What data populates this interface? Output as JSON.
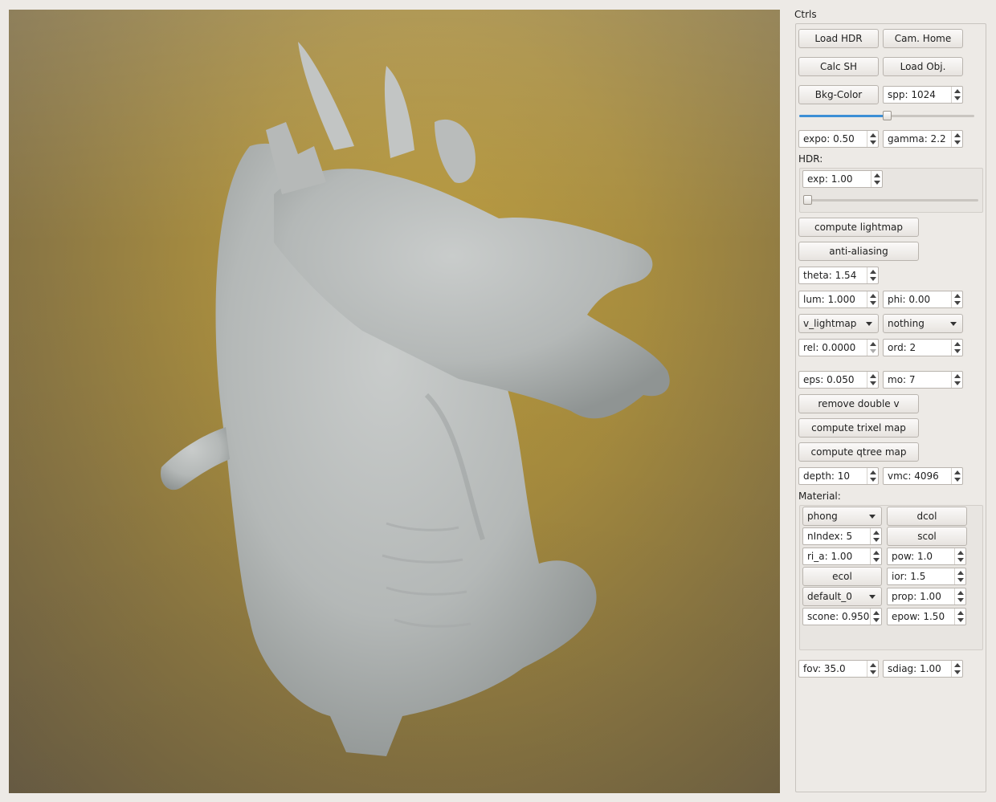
{
  "controls": {
    "title": "Ctrls",
    "load_hdr": "Load HDR",
    "cam_home": "Cam. Home",
    "calc_sh": "Calc SH",
    "load_obj": "Load Obj.",
    "bkg_color": "Bkg-Color",
    "spp": "spp: 1024",
    "spp_slider_level": 0.5,
    "expo": "expo: 0.50",
    "gamma": "gamma: 2.2",
    "hdr_label": "HDR:",
    "hdr_exp": "exp: 1.00",
    "hdr_slider_level": 0.0,
    "compute_lightmap": "compute lightmap",
    "anti_aliasing": "anti-aliasing",
    "theta": "theta: 1.54",
    "lum": "lum: 1.000",
    "phi": "phi: 0.00",
    "map_mode": "v_lightmap",
    "overlay_mode": "nothing",
    "rel": "rel: 0.0000",
    "ord": "ord: 2",
    "eps": "eps: 0.050",
    "mo": "mo: 7",
    "remove_double_v": "remove double v",
    "compute_trixel_map": "compute trixel map",
    "compute_qtree_map": "compute qtree map",
    "depth": "depth: 10",
    "vmc": "vmc: 4096",
    "fov": "fov: 35.0",
    "sdiag": "sdiag: 1.00"
  },
  "material": {
    "label": "Material:",
    "shader": "phong",
    "dcol": "dcol",
    "nindex": "nIndex: 5",
    "scol": "scol",
    "ri_a": "ri_a: 1.00",
    "pow": "pow: 1.0",
    "ecol": "ecol",
    "ior": "ior: 1.5",
    "material_name": "default_0",
    "prop": "prop: 1.00",
    "scone": "scone: 0.950",
    "epow": "epow: 1.50"
  },
  "colors": {
    "background_center": "#b99a3d",
    "background_edge": "#6e6147",
    "model": "#b9bcbb",
    "slider_accent": "#3d8fd6"
  }
}
